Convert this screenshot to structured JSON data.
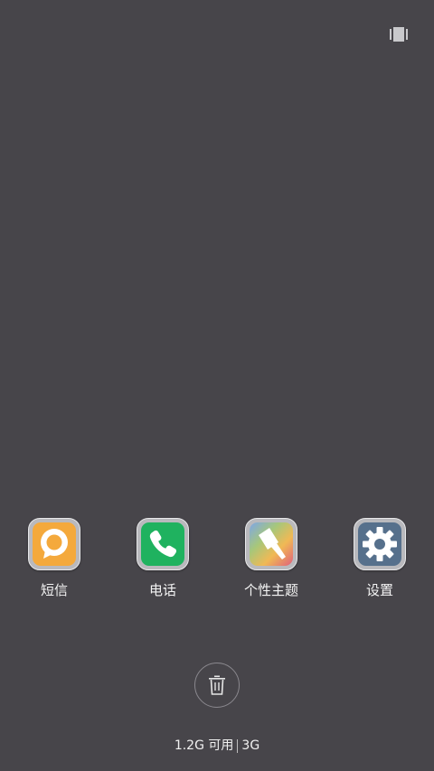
{
  "top_bar": {
    "view_toggle_icon": "recents-layout-icon"
  },
  "apps": [
    {
      "label": "短信",
      "icon": "messages-icon",
      "color": "#f4a93c"
    },
    {
      "label": "电话",
      "icon": "phone-icon",
      "color": "#1fb25f"
    },
    {
      "label": "个性主题",
      "icon": "themes-brush-icon",
      "color": "#8fa7d8"
    },
    {
      "label": "设置",
      "icon": "settings-gear-icon",
      "color": "#56708c"
    }
  ],
  "clear_button": {
    "icon": "trash-icon"
  },
  "memory": {
    "available": "1.2G 可用",
    "total": "3G"
  }
}
